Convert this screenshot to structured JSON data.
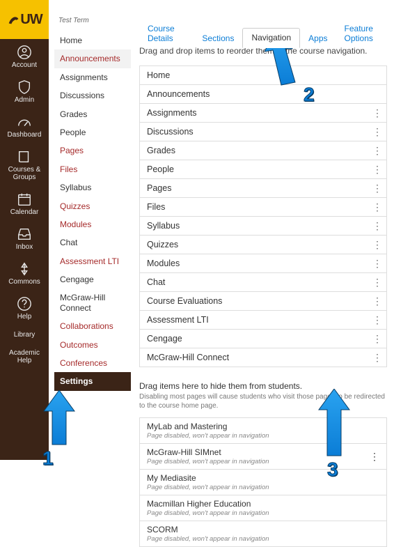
{
  "logo_text": "UW",
  "global_nav": [
    {
      "label": "Account",
      "icon": "user-circle"
    },
    {
      "label": "Admin",
      "icon": "shield"
    },
    {
      "label": "Dashboard",
      "icon": "gauge"
    },
    {
      "label": "Courses & Groups",
      "icon": "book"
    },
    {
      "label": "Calendar",
      "icon": "calendar"
    },
    {
      "label": "Inbox",
      "icon": "inbox"
    },
    {
      "label": "Commons",
      "icon": "commons"
    },
    {
      "label": "Help",
      "icon": "help"
    },
    {
      "label": "Library",
      "icon": ""
    },
    {
      "label": "Academic Help",
      "icon": ""
    }
  ],
  "term": "Test Term",
  "course_menu": [
    {
      "label": "Home",
      "mode": "normal"
    },
    {
      "label": "Announcements",
      "mode": "sel"
    },
    {
      "label": "Assignments",
      "mode": "normal"
    },
    {
      "label": "Discussions",
      "mode": "normal"
    },
    {
      "label": "Grades",
      "mode": "normal"
    },
    {
      "label": "People",
      "mode": "normal"
    },
    {
      "label": "Pages",
      "mode": "red"
    },
    {
      "label": "Files",
      "mode": "red"
    },
    {
      "label": "Syllabus",
      "mode": "normal"
    },
    {
      "label": "Quizzes",
      "mode": "red"
    },
    {
      "label": "Modules",
      "mode": "red"
    },
    {
      "label": "Chat",
      "mode": "normal"
    },
    {
      "label": "Assessment LTI",
      "mode": "red"
    },
    {
      "label": "Cengage",
      "mode": "normal"
    },
    {
      "label": "McGraw-Hill Connect",
      "mode": "normal"
    },
    {
      "label": "Collaborations",
      "mode": "red"
    },
    {
      "label": "Outcomes",
      "mode": "red"
    },
    {
      "label": "Conferences",
      "mode": "red"
    },
    {
      "label": "Settings",
      "mode": "settings"
    }
  ],
  "tabs": [
    {
      "label": "Course Details"
    },
    {
      "label": "Sections"
    },
    {
      "label": "Navigation",
      "active": true
    },
    {
      "label": "Apps"
    },
    {
      "label": "Feature Options"
    }
  ],
  "intro": "Drag and drop items to reorder them in the course navigation.",
  "enabled": [
    {
      "label": "Home",
      "dots": false
    },
    {
      "label": "Announcements",
      "dots": false
    },
    {
      "label": "Assignments",
      "dots": true
    },
    {
      "label": "Discussions",
      "dots": true
    },
    {
      "label": "Grades",
      "dots": true
    },
    {
      "label": "People",
      "dots": true
    },
    {
      "label": "Pages",
      "dots": true
    },
    {
      "label": "Files",
      "dots": true
    },
    {
      "label": "Syllabus",
      "dots": true
    },
    {
      "label": "Quizzes",
      "dots": true
    },
    {
      "label": "Modules",
      "dots": true
    },
    {
      "label": "Chat",
      "dots": true
    },
    {
      "label": "Course Evaluations",
      "dots": true
    },
    {
      "label": "Assessment LTI",
      "dots": true
    },
    {
      "label": "Cengage",
      "dots": true
    },
    {
      "label": "McGraw-Hill Connect",
      "dots": true
    }
  ],
  "hide_intro": "Drag items here to hide them from students.",
  "hide_sub": "Disabling most pages will cause students who visit those pages to be redirected to the course home page.",
  "disabled_sub": "Page disabled, won't appear in navigation",
  "disabled": [
    {
      "label": "MyLab and Mastering"
    },
    {
      "label": "McGraw-Hill SIMnet"
    },
    {
      "label": "My Mediasite"
    },
    {
      "label": "Macmillan Higher Education"
    },
    {
      "label": "SCORM"
    }
  ],
  "annotations": {
    "n1": "1",
    "n2": "2",
    "n3": "3"
  }
}
